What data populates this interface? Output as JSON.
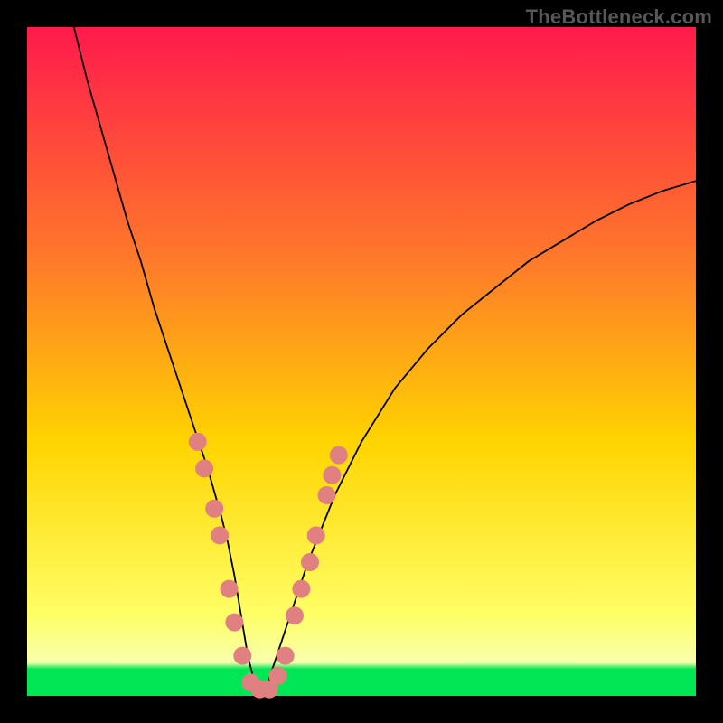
{
  "attribution": "TheBottleneck.com",
  "chart_data": {
    "type": "line",
    "title": "",
    "xlabel": "",
    "ylabel": "",
    "xlim": [
      0,
      100
    ],
    "ylim": [
      0,
      100
    ],
    "grid": false,
    "legend": false,
    "background_gradient": {
      "top_color": "#ff1a4c",
      "mid_colors": [
        "#ff7a2a",
        "#ffd400",
        "#ffff66"
      ],
      "bottom_band_color": "#00e756",
      "bottom_band_start": 96
    },
    "series": [
      {
        "name": "bottleneck-curve",
        "x": [
          7,
          9,
          11,
          13,
          15,
          17,
          19,
          21,
          23,
          25,
          27,
          29,
          30,
          31,
          32,
          33,
          34,
          35,
          36,
          38,
          40,
          42,
          44,
          46,
          50,
          55,
          60,
          65,
          70,
          75,
          80,
          85,
          90,
          95,
          100
        ],
        "y": [
          100,
          92,
          85,
          78,
          71,
          65,
          58,
          52,
          46,
          40,
          34,
          27,
          23,
          18,
          12,
          6,
          2,
          0,
          2,
          8,
          14,
          20,
          25,
          30,
          38,
          46,
          52,
          57,
          61,
          65,
          68,
          71,
          73.5,
          75.5,
          77
        ],
        "stroke": "#000000",
        "stroke_width": 1.8
      }
    ],
    "markers": {
      "name": "highlight-dots",
      "color": "#e08080",
      "radius": 10,
      "points": [
        {
          "x": 25.5,
          "y": 38
        },
        {
          "x": 26.5,
          "y": 34
        },
        {
          "x": 28.0,
          "y": 28
        },
        {
          "x": 28.8,
          "y": 24
        },
        {
          "x": 30.2,
          "y": 16
        },
        {
          "x": 31.0,
          "y": 11
        },
        {
          "x": 32.2,
          "y": 6
        },
        {
          "x": 33.4,
          "y": 2
        },
        {
          "x": 34.8,
          "y": 1
        },
        {
          "x": 36.2,
          "y": 1
        },
        {
          "x": 37.5,
          "y": 3
        },
        {
          "x": 38.6,
          "y": 6
        },
        {
          "x": 40.0,
          "y": 12
        },
        {
          "x": 41.0,
          "y": 16
        },
        {
          "x": 42.3,
          "y": 20
        },
        {
          "x": 43.2,
          "y": 24
        },
        {
          "x": 44.8,
          "y": 30
        },
        {
          "x": 45.6,
          "y": 33
        },
        {
          "x": 46.6,
          "y": 36
        }
      ]
    }
  }
}
